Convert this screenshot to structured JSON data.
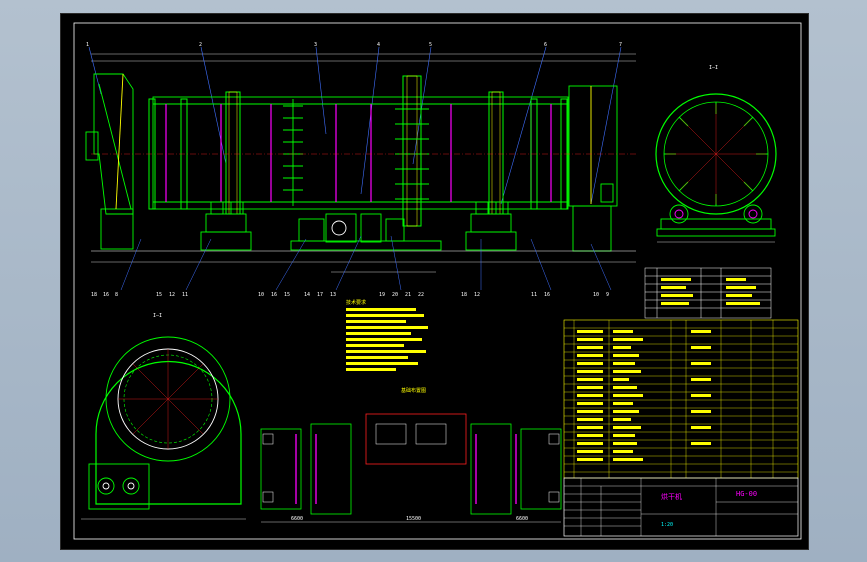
{
  "drawing": {
    "title_cn": "烘干机",
    "drawing_no": "HG-00",
    "scale_note": "1:20",
    "section_label_a": "I—I",
    "section_label_b": "I—I",
    "detail_title": "基础布置图",
    "tech_title": "技术要求",
    "dim_left_bottom": "6600",
    "dim_mid_bottom": "15500",
    "dim_right_bottom": "6600",
    "callouts": [
      "1",
      "2",
      "3",
      "4",
      "5",
      "6",
      "7"
    ],
    "bottom_callouts": [
      "18",
      "16",
      "8",
      "15",
      "12",
      "11",
      "10",
      "16",
      "15",
      "14",
      "17",
      "13",
      "19",
      "20",
      "21",
      "22",
      "18",
      "12",
      "11",
      "16",
      "10",
      "9"
    ]
  },
  "colors": {
    "viewport_bg": "#000000",
    "green": "#00ff00",
    "yellow": "#ffff00",
    "magenta": "#ff00ff",
    "cyan": "#00ffff",
    "blue": "#3f6fff",
    "red": "#ff2020",
    "white": "#ffffff"
  }
}
